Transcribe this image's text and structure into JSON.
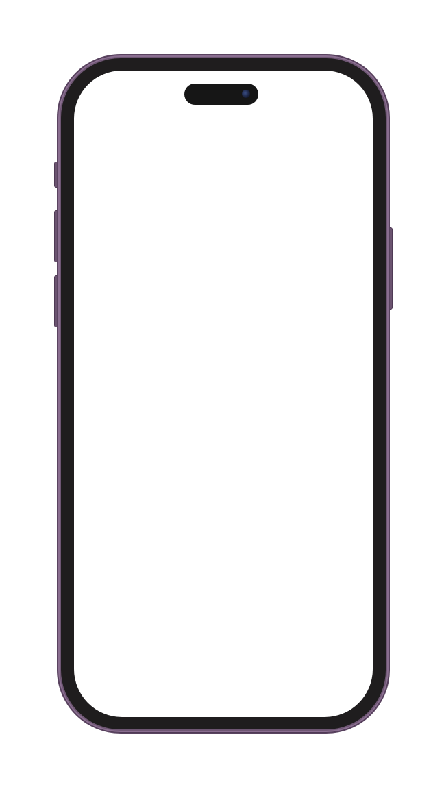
{
  "device": {
    "frame_color": "#6e5673",
    "bezel_color": "#1f1d1e",
    "screen_color": "#ffffff",
    "island_color": "#161616"
  },
  "icons": {
    "camera": "front-camera-icon"
  }
}
